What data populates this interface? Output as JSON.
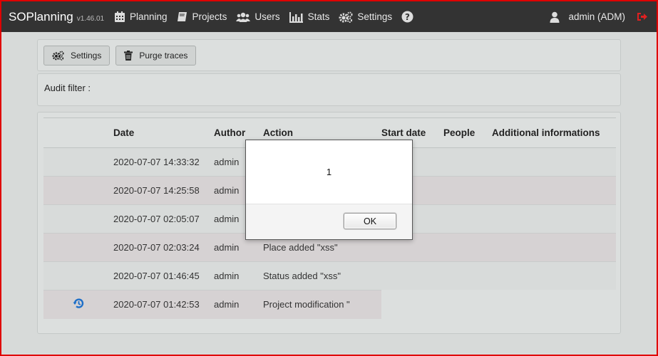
{
  "brand": {
    "name": "SOPlanning",
    "version": "v1.46.01"
  },
  "nav": {
    "items": [
      {
        "label": "Planning",
        "icon": "calendar-icon"
      },
      {
        "label": "Projects",
        "icon": "book-icon"
      },
      {
        "label": "Users",
        "icon": "users-icon"
      },
      {
        "label": "Stats",
        "icon": "bar-chart-icon"
      },
      {
        "label": "Settings",
        "icon": "gears-icon"
      }
    ],
    "help_icon": "question-circle-icon",
    "user_label": "admin (ADM)",
    "user_icon": "user-icon",
    "logout_icon": "sign-out-icon"
  },
  "toolbar": {
    "settings_label": "Settings",
    "purge_label": "Purge traces"
  },
  "filter": {
    "label": "Audit filter :"
  },
  "table": {
    "headers": [
      "",
      "Date",
      "Author",
      "Action",
      "Start date",
      "People",
      "Additional informations"
    ],
    "rows": [
      {
        "date": "2020-07-07 14:33:32",
        "author": "admin",
        "action": ""
      },
      {
        "date": "2020-07-07 14:25:58",
        "author": "admin",
        "action": ""
      },
      {
        "date": "2020-07-07 02:05:07",
        "author": "admin",
        "action": ""
      },
      {
        "date": "2020-07-07 02:03:24",
        "author": "admin",
        "action": "Place added \"xss\""
      },
      {
        "date": "2020-07-07 01:46:45",
        "author": "admin",
        "action": "Status added \"xss\""
      },
      {
        "date": "2020-07-07 01:42:53",
        "author": "admin",
        "action": "Project modification \"",
        "icon": "history-icon"
      }
    ]
  },
  "dialog": {
    "message": "1",
    "ok_label": "OK"
  },
  "colors": {
    "navbar": "#333333",
    "accent_red": "#e02020",
    "history_blue": "#1e6fc8"
  }
}
